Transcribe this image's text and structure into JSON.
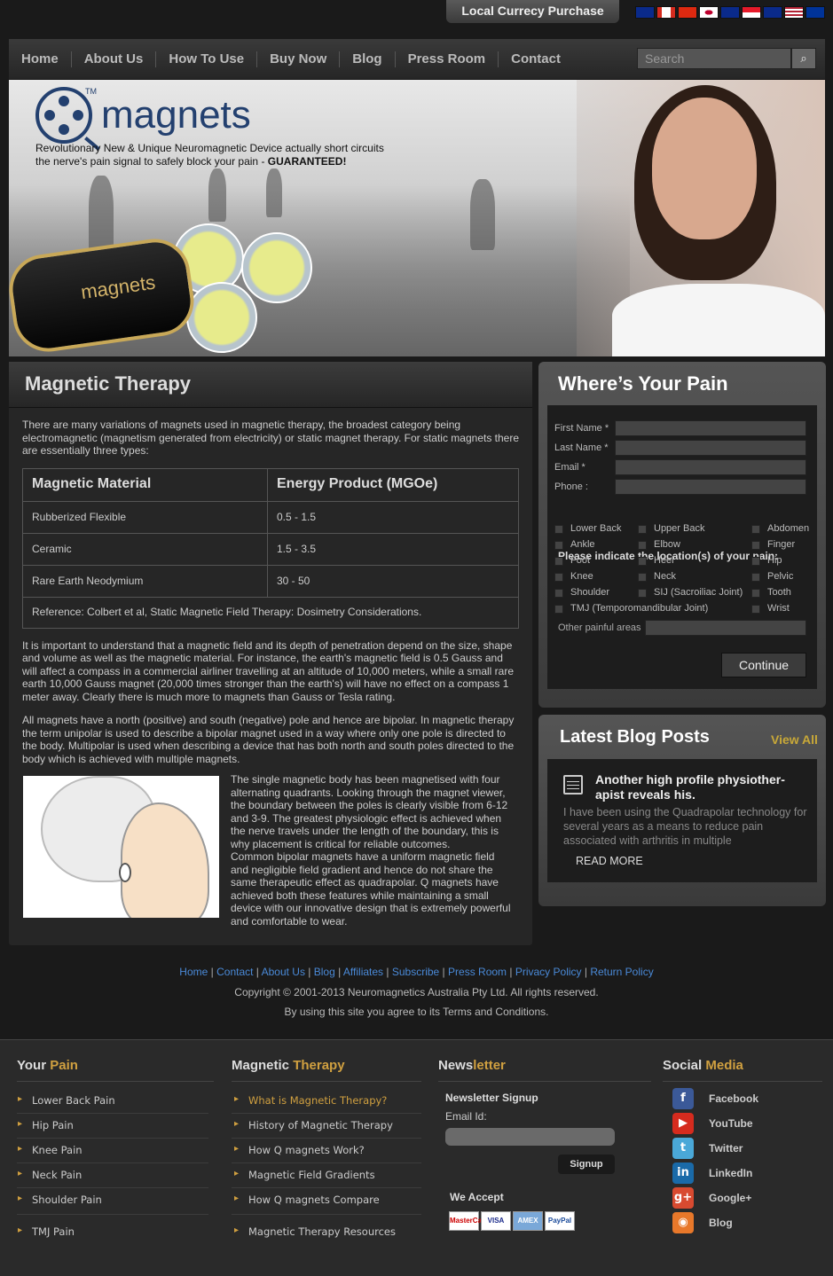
{
  "topbar": {
    "currency_label": "Local Currecy Purchase",
    "flags": [
      "#0a2a8a",
      "#d52b1e",
      "#de2910",
      "#ffffff",
      "#0a2a8a",
      "#e61a2a",
      "#0a2a8a",
      "#b22234",
      "#003399"
    ]
  },
  "nav": {
    "items": [
      "Home",
      "About Us",
      "How To Use",
      "Buy Now",
      "Blog",
      "Press Room",
      "Contact"
    ],
    "search_placeholder": "Search",
    "search_icon": "search-icon"
  },
  "banner": {
    "logo_text": "magnets",
    "logo_tm": "TM",
    "tagline_1": "Revolutionary New & Unique Neuromagnetic Device actually short circuits",
    "tagline_2": "the nerve's pain signal to safely block your pain - ",
    "tagline_bold": "GUARANTEED!",
    "case_text": "magnets"
  },
  "main": {
    "title": "Magnetic Therapy",
    "intro": "There are many variations of magnets used in magnetic therapy, the broadest category being electromagnetic (magnetism generated from electricity) or static magnet therapy. For static magnets there are essentially three types:",
    "table": {
      "headers": [
        "Magnetic Material",
        "Energy Product (MGOe)"
      ],
      "rows": [
        [
          "Rubberized Flexible",
          "0.5 - 1.5"
        ],
        [
          "Ceramic",
          "1.5 - 3.5"
        ],
        [
          "Rare Earth Neodymium",
          "30 - 50"
        ]
      ],
      "reference": "Reference: Colbert et al, Static Magnetic Field Therapy: Dosimetry Considerations."
    },
    "para1": "It is important to understand that a magnetic field and its depth of penetration depend on the size, shape and volume as well as the magnetic material. For instance, the earth's magnetic field is 0.5 Gauss and will affect a compass in a commercial airliner travelling at an altitude of 10,000 meters, while a small rare earth 10,000 Gauss magnet (20,000 times stronger than the earth's) will have no effect on a compass 1 meter away. Clearly there is much more to magnets than Gauss or Tesla rating.",
    "para2": "All magnets have a north (positive) and south (negative) pole and hence are bipolar. In magnetic therapy the term unipolar is used to describe a bipolar magnet used in a way where only one pole is directed to the body. Multipolar is used when describing a device that has both north and south poles directed to the body which is achieved with multiple magnets.",
    "para3": "The single magnetic body has been magnetised with four alternating quadrants. Looking through the magnet viewer, the boundary between the poles is clearly visible from 6-12 and 3-9. The greatest physiologic effect is achieved when the nerve travels under the length of the boundary, this is why placement is critical for reliable outcomes.",
    "para4": "Common bipolar magnets have a uniform magnetic field and negligible field gradient and hence do not share the same therapeutic effect as quadrapolar. Q magnets have achieved both these features while maintaining a small device with our innovative design that is extremely powerful and comfortable to wear."
  },
  "pain": {
    "title": "Where’s Your Pain",
    "fields": [
      "First Name *",
      "Last Name *",
      "Email *",
      "Phone :"
    ],
    "question": "Please indicate the location(s) of your pain:",
    "locations": [
      [
        "Lower Back",
        "Upper Back",
        "Abdomen"
      ],
      [
        "Ankle",
        "Elbow",
        "Finger"
      ],
      [
        "Foot",
        "Heel",
        "Hip"
      ],
      [
        "Knee",
        "Neck",
        "Pelvic"
      ],
      [
        "Shoulder",
        "SIJ (Sacroiliac Joint)",
        "Tooth"
      ],
      [
        "TMJ (Temporomandibular Joint)",
        "",
        "Wrist"
      ]
    ],
    "other_label": "Other painful areas",
    "continue_label": "Continue"
  },
  "blog": {
    "title": "Latest Blog Posts",
    "view_all": "View All",
    "post_title": "Another high profile physiother-apist reveals his.",
    "post_excerpt": "I have been using the Quadrapolar technology for several years as a means to reduce pain associated with arthritis in multiple",
    "read_more": "READ MORE"
  },
  "footer": {
    "links": [
      "Home",
      "Contact",
      "About Us",
      "Blog",
      "Affiliates",
      "Subscribe",
      "Press Room",
      "Privacy Policy",
      "Return Policy"
    ],
    "copyright": "Copyright © 2001-2013 Neuromagnetics Australia Pty Ltd. All rights reserved.",
    "terms": "By using this site you agree to its Terms and Conditions."
  },
  "bottom": {
    "your_pain": {
      "title_a": "Your ",
      "title_b": "Pain",
      "items": [
        "Lower Back Pain",
        "Hip Pain",
        "Knee Pain",
        "Neck Pain",
        "Shoulder Pain",
        "TMJ Pain"
      ]
    },
    "magnetic_therapy": {
      "title_a": "Magnetic ",
      "title_b": "Therapy",
      "items": [
        "What is Magnetic Therapy?",
        "History of Magnetic Therapy",
        "How Q magnets Work?",
        "Magnetic Field Gradients",
        "How Q magnets Compare",
        "Magnetic Therapy Resources"
      ]
    },
    "newsletter": {
      "title_a": "News",
      "title_b": "letter",
      "heading": "Newsletter Signup",
      "email_label": "Email Id:",
      "signup_label": "Signup",
      "accept_label": "We Accept",
      "cards": [
        "MasterCard",
        "VISA",
        "AMEX",
        "PayPal"
      ]
    },
    "social": {
      "title_a": "Social ",
      "title_b": "Media",
      "items": [
        {
          "label": "Facebook",
          "glyph": "f",
          "color": "#3b5998"
        },
        {
          "label": "YouTube",
          "glyph": "▶",
          "color": "#d52b1e"
        },
        {
          "label": "Twitter",
          "glyph": "t",
          "color": "#4aa8d8"
        },
        {
          "label": "LinkedIn",
          "glyph": "in",
          "color": "#1a6aa8"
        },
        {
          "label": "Google+",
          "glyph": "g+",
          "color": "#d84a30"
        },
        {
          "label": "Blog",
          "glyph": "◉",
          "color": "#e8782a"
        }
      ]
    }
  }
}
